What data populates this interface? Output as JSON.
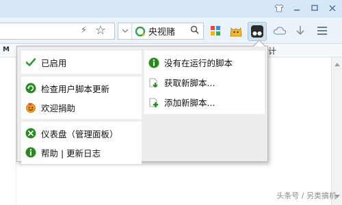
{
  "toolbar": {
    "search_query": "央视赌"
  },
  "bookmarks": {
    "first_label": "M",
    "last_label": "计"
  },
  "menu": {
    "left_groups": [
      [
        {
          "label": "已启用",
          "icon": "check-icon"
        }
      ],
      [
        {
          "label": "检查用户脚本更新",
          "icon": "refresh-icon"
        },
        {
          "label": "欢迎捐助",
          "icon": "smiley-icon"
        }
      ],
      [
        {
          "label": "仪表盘（管理面板）",
          "icon": "dashboard-icon"
        },
        {
          "label": "帮助 | 更新日志",
          "icon": "info-icon"
        }
      ]
    ],
    "right_items": [
      {
        "label": "没有在运行的脚本",
        "icon": "info-icon"
      },
      {
        "label": "获取新脚本...",
        "icon": "get-script-icon"
      },
      {
        "label": "添加新脚本...",
        "icon": "add-script-icon"
      }
    ]
  },
  "watermark": "头条号 / 另类搞机",
  "colors": {
    "green": "#2f8f1f",
    "menu_bg": "#ededed",
    "toolbar_bg": "#eaf2fa"
  }
}
